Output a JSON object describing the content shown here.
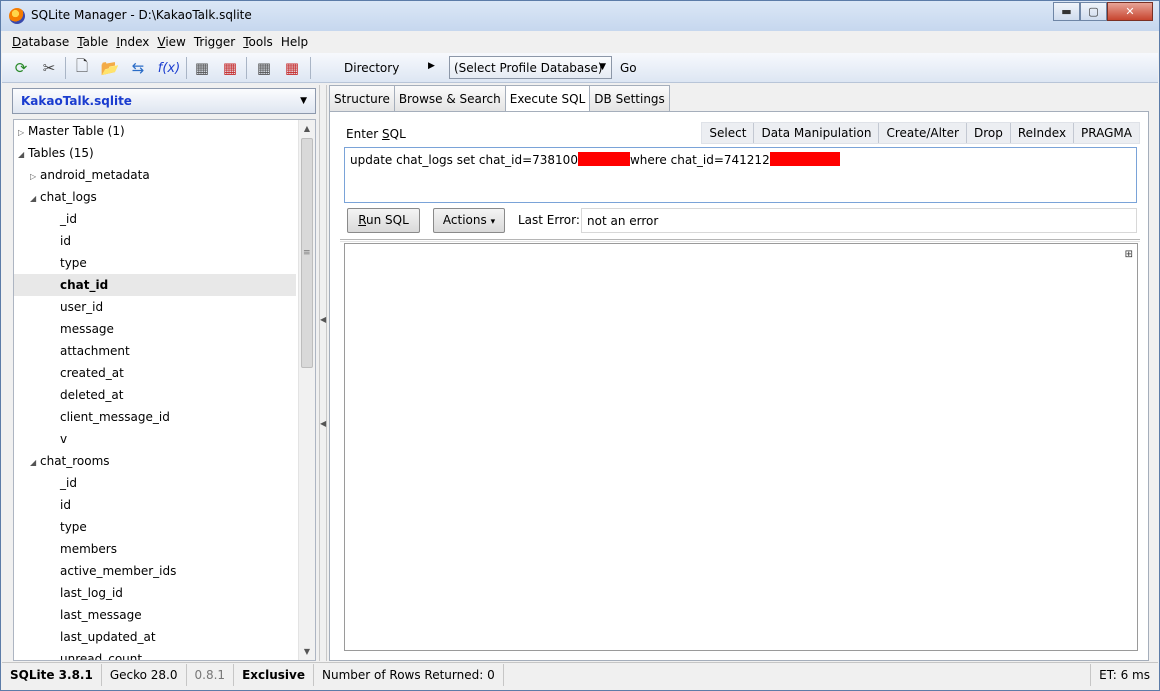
{
  "window": {
    "title": "SQLite Manager - D:\\KakaoTalk.sqlite",
    "btn_min": "▬",
    "btn_max": "▢",
    "btn_close": "✕"
  },
  "menu": {
    "items": [
      {
        "key": "D",
        "rest": "atabase"
      },
      {
        "key": "T",
        "rest": "able"
      },
      {
        "key": "I",
        "rest": "ndex"
      },
      {
        "key": "V",
        "rest": "iew"
      },
      {
        "key": "",
        "rest": "Trigger"
      },
      {
        "key": "T",
        "rest": "ools"
      },
      {
        "key": "",
        "rest": "Help"
      }
    ]
  },
  "toolbar": {
    "icons": [
      "refresh-icon",
      "tools-icon",
      "new-file-icon",
      "open-folder-icon",
      "connect-icon",
      "function-icon",
      "create-table-icon",
      "drop-table-icon",
      "create-index-icon",
      "drop-index-icon"
    ],
    "glyphs": {
      "refresh": "⟳",
      "tools": "✂",
      "newfile": "🗋",
      "open": "📂",
      "connect": "⇆",
      "function": "f(x)",
      "ctable": "▦",
      "dtable": "▦",
      "cindex": "▦",
      "dindex": "▦"
    },
    "directory_label": "Directory",
    "directory_arrow": "▶",
    "profile_select": "(Select Profile Database)",
    "select_arrow": "▼",
    "go_label": "Go"
  },
  "left": {
    "db_select": "KakaoTalk.sqlite",
    "tree": [
      {
        "label": "Master Table (1)",
        "level": 0,
        "toggle": "▷"
      },
      {
        "label": "Tables (15)",
        "level": 0,
        "toggle": "◢"
      },
      {
        "label": "android_metadata",
        "level": 1,
        "toggle": "▷"
      },
      {
        "label": "chat_logs",
        "level": 1,
        "toggle": "◢"
      },
      {
        "label": "_id",
        "level": 2,
        "toggle": ""
      },
      {
        "label": "id",
        "level": 2,
        "toggle": ""
      },
      {
        "label": "type",
        "level": 2,
        "toggle": ""
      },
      {
        "label": "chat_id",
        "level": 2,
        "toggle": "",
        "selected": true
      },
      {
        "label": "user_id",
        "level": 2,
        "toggle": ""
      },
      {
        "label": "message",
        "level": 2,
        "toggle": ""
      },
      {
        "label": "attachment",
        "level": 2,
        "toggle": ""
      },
      {
        "label": "created_at",
        "level": 2,
        "toggle": ""
      },
      {
        "label": "deleted_at",
        "level": 2,
        "toggle": ""
      },
      {
        "label": "client_message_id",
        "level": 2,
        "toggle": ""
      },
      {
        "label": "v",
        "level": 2,
        "toggle": ""
      },
      {
        "label": "chat_rooms",
        "level": 1,
        "toggle": "◢"
      },
      {
        "label": "_id",
        "level": 2,
        "toggle": ""
      },
      {
        "label": "id",
        "level": 2,
        "toggle": ""
      },
      {
        "label": "type",
        "level": 2,
        "toggle": ""
      },
      {
        "label": "members",
        "level": 2,
        "toggle": ""
      },
      {
        "label": "active_member_ids",
        "level": 2,
        "toggle": ""
      },
      {
        "label": "last_log_id",
        "level": 2,
        "toggle": ""
      },
      {
        "label": "last_message",
        "level": 2,
        "toggle": ""
      },
      {
        "label": "last_updated_at",
        "level": 2,
        "toggle": ""
      },
      {
        "label": "unread_count",
        "level": 2,
        "toggle": ""
      }
    ],
    "scroll_up": "▲",
    "scroll_down": "▼",
    "scroll_grip": "≡"
  },
  "tabs": [
    "Structure",
    "Browse & Search",
    "Execute SQL",
    "DB Settings"
  ],
  "active_tab": 2,
  "execute": {
    "enter_sql_pre": "Enter ",
    "enter_sql_key": "S",
    "enter_sql_post": "QL",
    "quick_links": [
      "Select",
      "Data Manipulation",
      "Create/Alter",
      "Drop",
      "ReIndex",
      "PRAGMA"
    ],
    "sql_part1": "update chat_logs set chat_id=738100",
    "sql_part2": "where chat_id=741212",
    "run_key": "R",
    "run_rest": "un SQL",
    "actions_label": "Actions",
    "actions_arrow": "▾",
    "last_error_label": "Last Error:",
    "last_error_value": "not an error",
    "column_picker": "⊞"
  },
  "status": {
    "sqlite_version": "SQLite 3.8.1",
    "gecko": "Gecko 28.0",
    "ext_version": "0.8.1",
    "mode": "Exclusive",
    "rows": "Number of Rows Returned: 0",
    "et": "ET: 6 ms"
  },
  "colors": {
    "accent": "#1a3ccf",
    "redaction": "#ff0000"
  }
}
